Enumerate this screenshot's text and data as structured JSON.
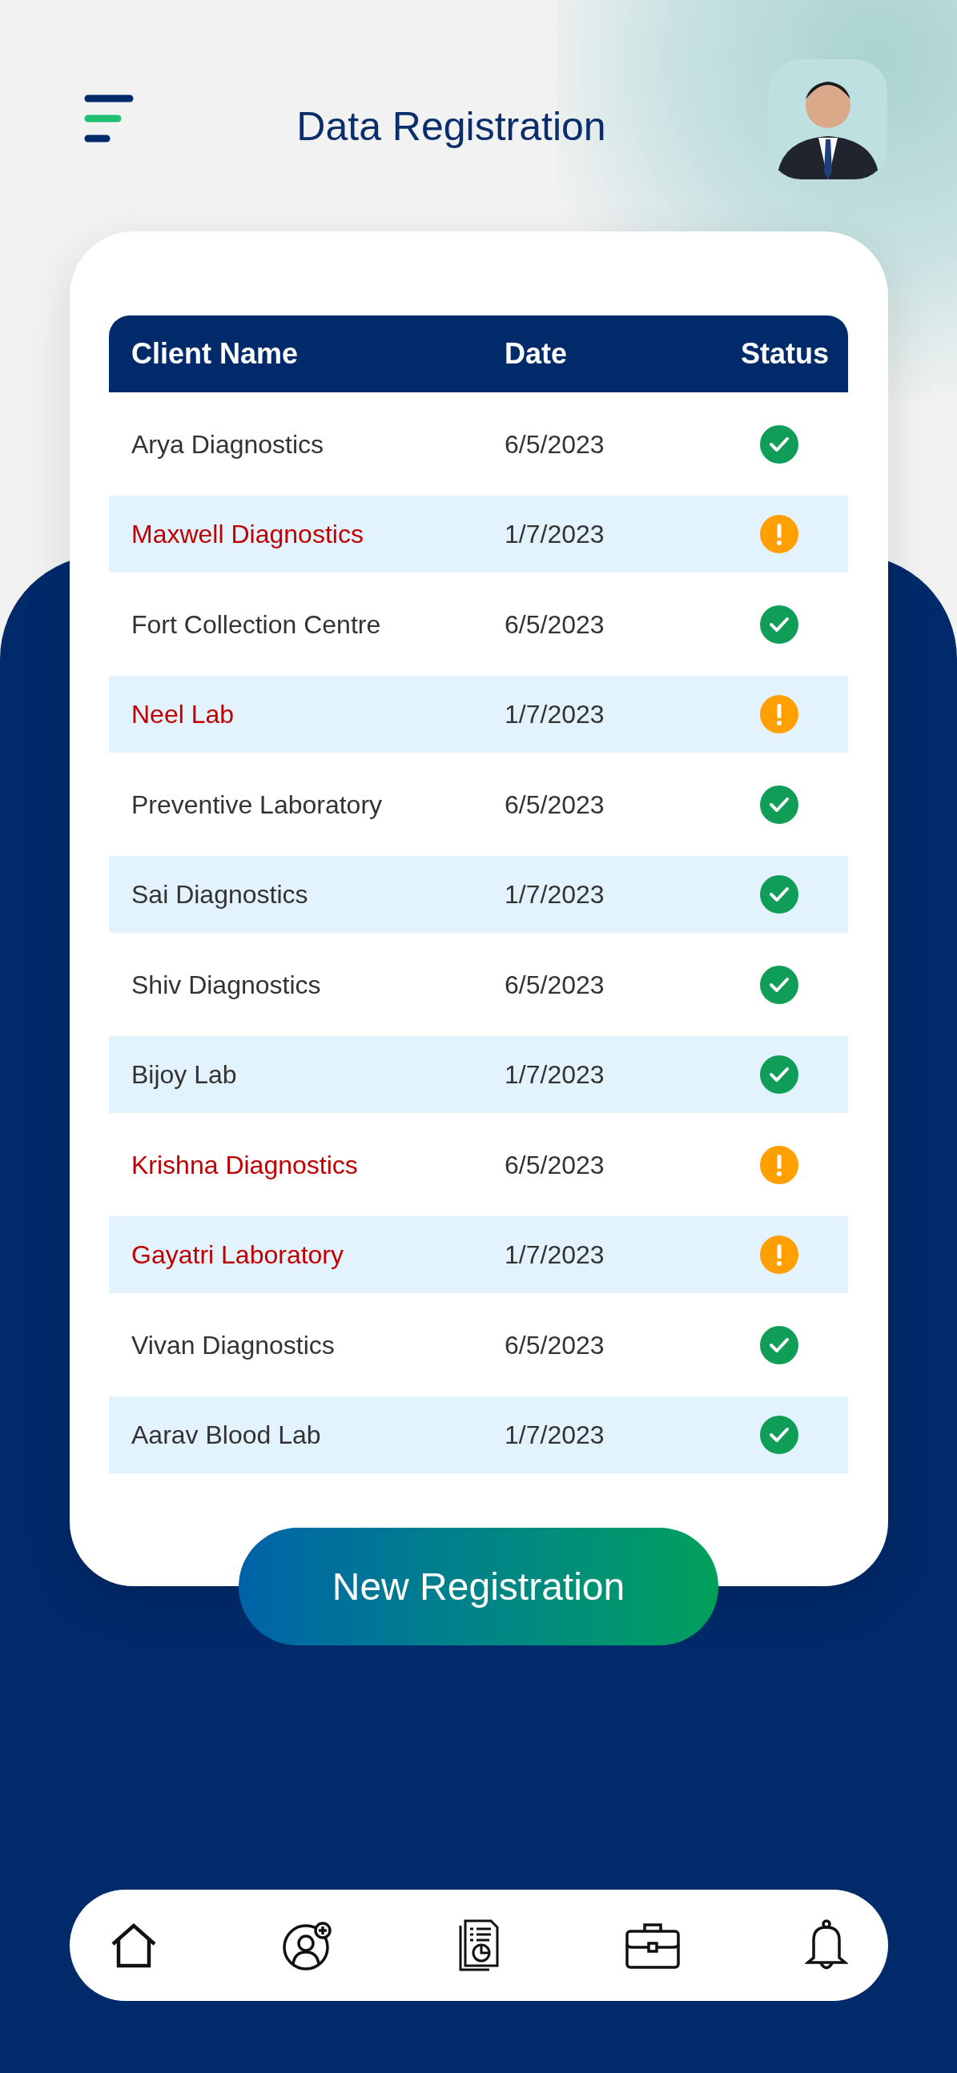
{
  "header": {
    "title": "Data Registration"
  },
  "table": {
    "columns": [
      "Client Name",
      "Date",
      "Status"
    ],
    "rows": [
      {
        "client": "Arya Diagnostics",
        "date": "6/5/2023",
        "verified": true
      },
      {
        "client": "Maxwell Diagnostics",
        "date": "1/7/2023",
        "verified": false
      },
      {
        "client": "Fort Collection Centre",
        "date": "6/5/2023",
        "verified": true
      },
      {
        "client": "Neel Lab",
        "date": "1/7/2023",
        "verified": false
      },
      {
        "client": "Preventive Laboratory",
        "date": "6/5/2023",
        "verified": true
      },
      {
        "client": "Sai Diagnostics",
        "date": "1/7/2023",
        "verified": true
      },
      {
        "client": "Shiv Diagnostics",
        "date": "6/5/2023",
        "verified": true
      },
      {
        "client": "Bijoy Lab",
        "date": "1/7/2023",
        "verified": true
      },
      {
        "client": "Krishna Diagnostics",
        "date": "6/5/2023",
        "verified": false
      },
      {
        "client": "Gayatri Laboratory",
        "date": "1/7/2023",
        "verified": false
      },
      {
        "client": "Vivan Diagnostics",
        "date": "6/5/2023",
        "verified": true
      },
      {
        "client": "Aarav Blood Lab",
        "date": "1/7/2023",
        "verified": true
      }
    ]
  },
  "button": {
    "label": "New Registration"
  }
}
